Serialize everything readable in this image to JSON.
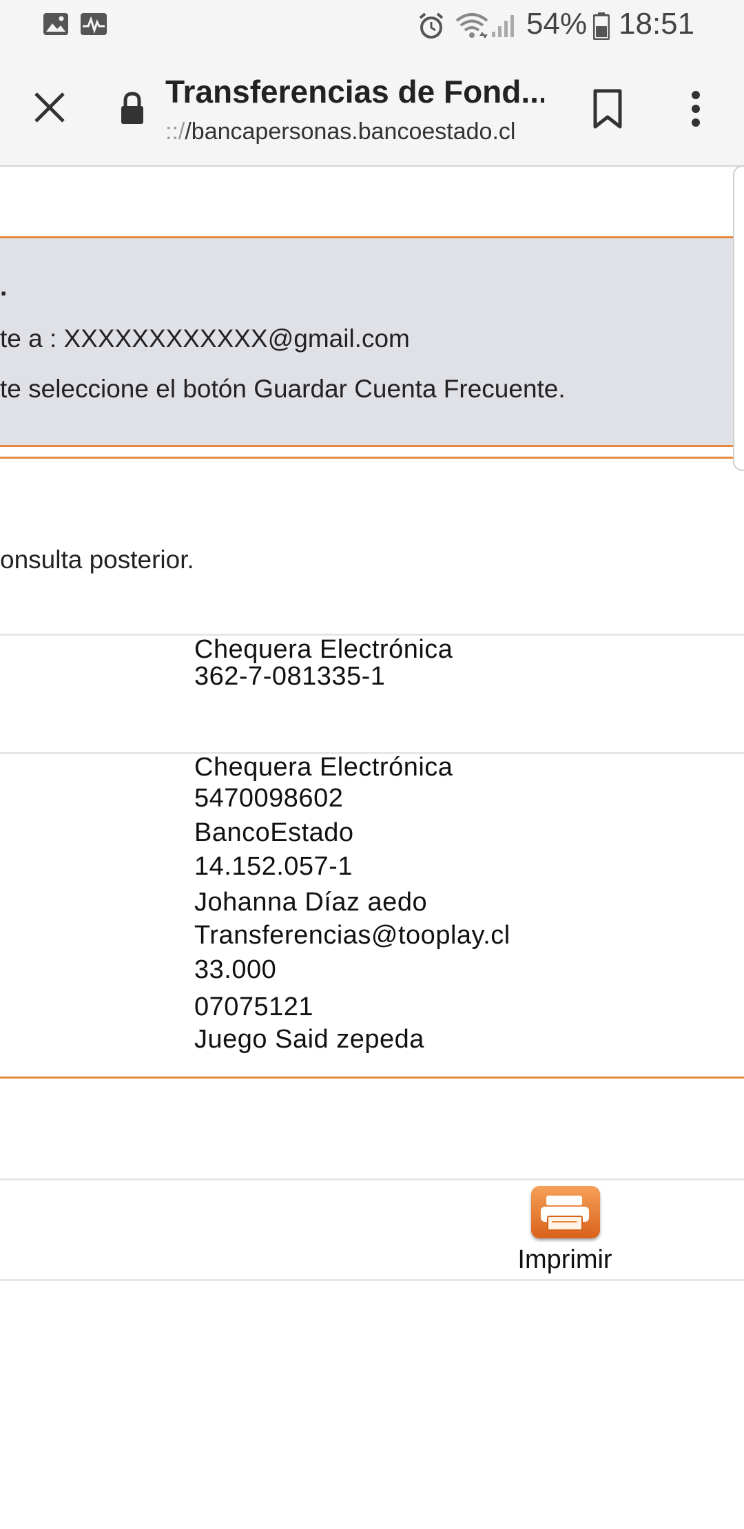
{
  "status_bar": {
    "battery": "54%",
    "time": "18:51",
    "icons": [
      "image-icon",
      "activity-icon",
      "alarm-icon",
      "wifi-icon",
      "signal-icon",
      "battery-icon"
    ]
  },
  "browser": {
    "title": "Transferencias de Fond...",
    "url_scheme": "::/",
    "url_host": "/bancapersonas.bancoestado.cl",
    "icons": [
      "close-icon",
      "lock-icon",
      "bookmark-icon",
      "more-vert-icon"
    ]
  },
  "notice": {
    "line1": ".",
    "line2": "te a : XXXXXXXXXXXX@gmail.com",
    "line3": "te seleccione el botón Guardar Cuenta Frecuente."
  },
  "consulta_text": "onsulta posterior.",
  "origin": {
    "account_type": "Chequera Electrónica",
    "account_number": "362-7-081335-1"
  },
  "destination": {
    "account_type": "Chequera Electrónica",
    "account_number": "5470098602",
    "bank": "BancoEstado",
    "rut": "14.152.057-1",
    "name": "Johanna Díaz aedo",
    "email": "Transferencias@tooplay.cl",
    "amount": "33.000",
    "code": "07075121",
    "comment": "Juego Said zepeda"
  },
  "actions": {
    "print_label": "Imprimir"
  },
  "colors": {
    "accent": "#e5893f",
    "notice_bg": "#e0e1e7"
  }
}
